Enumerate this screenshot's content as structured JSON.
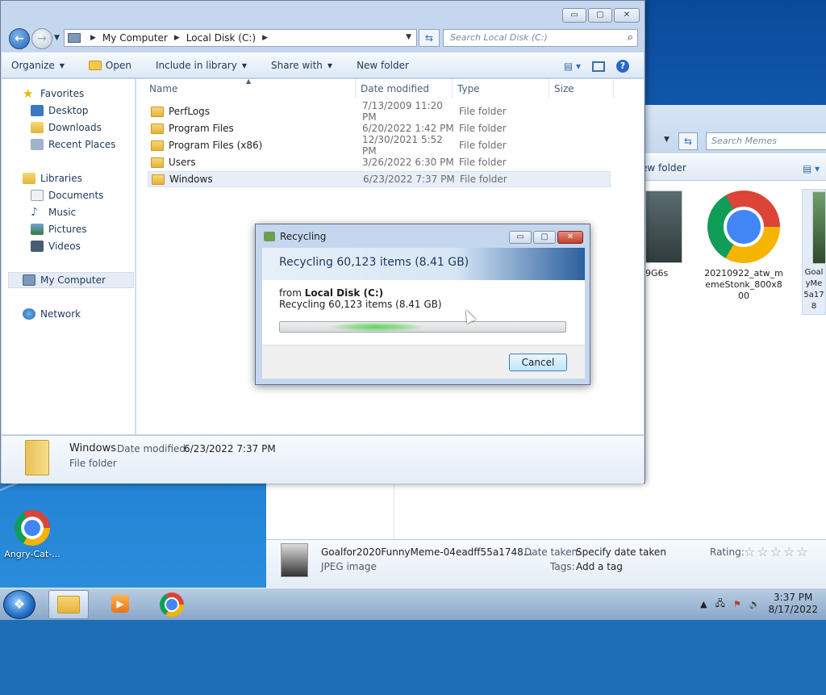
{
  "desktop": {
    "icon_label": "Angry-Cat-..."
  },
  "explorer": {
    "window_buttons": {
      "minimize": "▭",
      "maximize": "▢",
      "close": "✕"
    },
    "breadcrumb": [
      "My Computer",
      "Local Disk (C:)"
    ],
    "search_placeholder": "Search Local Disk (C:)",
    "toolbar": {
      "organize": "Organize",
      "open": "Open",
      "include_in_library": "Include in library",
      "share_with": "Share with",
      "new_folder": "New folder"
    },
    "nav": {
      "favorites": "Favorites",
      "desktop": "Desktop",
      "downloads": "Downloads",
      "recent_places": "Recent Places",
      "libraries": "Libraries",
      "documents": "Documents",
      "music": "Music",
      "pictures": "Pictures",
      "videos": "Videos",
      "my_computer": "My Computer",
      "network": "Network"
    },
    "columns": {
      "name": "Name",
      "date": "Date modified",
      "type": "Type",
      "size": "Size"
    },
    "rows": [
      {
        "name": "PerfLogs",
        "date": "7/13/2009 11:20 PM",
        "type": "File folder"
      },
      {
        "name": "Program Files",
        "date": "6/20/2022 1:42 PM",
        "type": "File folder"
      },
      {
        "name": "Program Files (x86)",
        "date": "12/30/2021 5:52 PM",
        "type": "File folder"
      },
      {
        "name": "Users",
        "date": "3/26/2022 6:30 PM",
        "type": "File folder"
      },
      {
        "name": "Windows",
        "date": "6/23/2022 7:37 PM",
        "type": "File folder"
      }
    ],
    "details": {
      "name": "Windows",
      "date_label": "Date modified:",
      "date_value": "6/23/2022 7:37 PM",
      "type": "File folder"
    }
  },
  "dialog": {
    "title": "Recycling",
    "heading": "Recycling 60,123 items (8.41 GB)",
    "from_label": "from",
    "from_value": "Local Disk (C:)",
    "status": "Recycling 60,123 items (8.41 GB)",
    "cancel": "Cancel"
  },
  "memes_window": {
    "search_placeholder": "Search Memes",
    "new_folder": "ew folder",
    "thumb1_label": "9G6s",
    "thumb2_label": "20210922_atw_memeStonk_800x800",
    "thumb3_label": "Goal yMe 5a17 8",
    "details": {
      "filename": "Goalfor2020FunnyMeme-04eadff55a1748...",
      "type": "JPEG image",
      "date_taken_label": "Date taken:",
      "date_taken_value": "Specify date taken",
      "tags_label": "Tags:",
      "tags_value": "Add a tag",
      "rating_label": "Rating:",
      "stars": "☆☆☆☆☆"
    }
  },
  "taskbar": {
    "time": "3:37 PM",
    "date": "8/17/2022"
  }
}
